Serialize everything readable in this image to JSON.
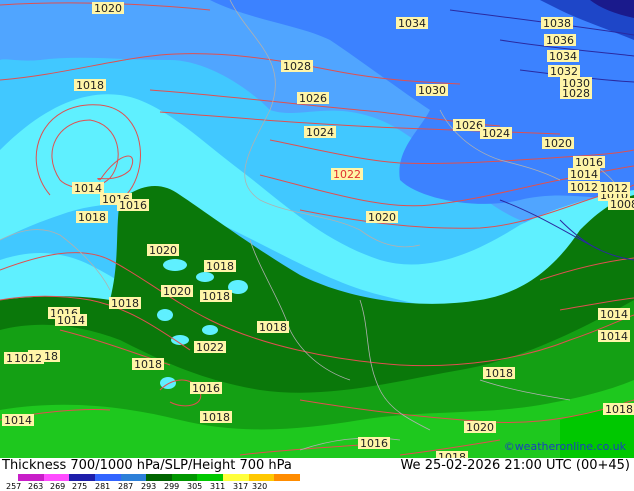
{
  "title": "Thickness 700/1000 hPa/SLP/Height 700 hPa",
  "datetime": "We 25-02-2026 21:00 UTC (00+45)",
  "credit": "©weatheronline.co.uk",
  "legend": {
    "ticks": [
      "257",
      "263",
      "269",
      "275",
      "281",
      "287",
      "293",
      "299",
      "305",
      "311",
      "317",
      "320"
    ],
    "colors": [
      "#c81ec8",
      "#ff4cff",
      "#1e1eaa",
      "#3264ff",
      "#2c7fd8",
      "#006400",
      "#009600",
      "#00c800",
      "#ffff3c",
      "#ffc800",
      "#ff8c00"
    ]
  },
  "fill_colors": {
    "dark_blue": "#1e46c8",
    "blue": "#3c82ff",
    "medium_blue": "#50a5ff",
    "light_blue": "#41c8ff",
    "cyan": "#5ff0ff",
    "dark_green": "#0a780a",
    "green": "#14a014",
    "light_green": "#1ec81e",
    "isobar": "#e05050"
  },
  "isobar_labels": [
    {
      "text": "1020"
    },
    {
      "text": "1034"
    },
    {
      "text": "1038"
    },
    {
      "text": "1036"
    },
    {
      "text": "1034"
    },
    {
      "text": "1032"
    },
    {
      "text": "1030"
    },
    {
      "text": "1028"
    },
    {
      "text": "1018"
    },
    {
      "text": "1028"
    },
    {
      "text": "1030"
    },
    {
      "text": "1026"
    },
    {
      "text": "1024"
    },
    {
      "text": "1026"
    },
    {
      "text": "1024"
    },
    {
      "text": "1020"
    },
    {
      "text": "1016"
    },
    {
      "text": "1014"
    },
    {
      "text": "1012"
    },
    {
      "text": "1010"
    },
    {
      "text": "1008"
    },
    {
      "text": "1022"
    },
    {
      "text": "1014"
    },
    {
      "text": "1016"
    },
    {
      "text": "1016"
    },
    {
      "text": "1018"
    },
    {
      "text": "1020"
    },
    {
      "text": "1020"
    },
    {
      "text": "1018"
    },
    {
      "text": "1020"
    },
    {
      "text": "1018"
    },
    {
      "text": "1016"
    },
    {
      "text": "1018"
    },
    {
      "text": "1014"
    },
    {
      "text": "1020"
    },
    {
      "text": "1022"
    },
    {
      "text": "1018"
    },
    {
      "text": "1014"
    },
    {
      "text": "1012"
    },
    {
      "text": "1018"
    },
    {
      "text": "1016"
    },
    {
      "text": "1018"
    },
    {
      "text": "1018"
    },
    {
      "text": "1018"
    },
    {
      "text": "1020"
    },
    {
      "text": "1016"
    },
    {
      "text": "1018"
    },
    {
      "text": "1014"
    },
    {
      "text": "1018"
    },
    {
      "text": "1014"
    },
    {
      "text": "1012"
    },
    {
      "text": "1012"
    },
    {
      "text": "1014"
    }
  ]
}
